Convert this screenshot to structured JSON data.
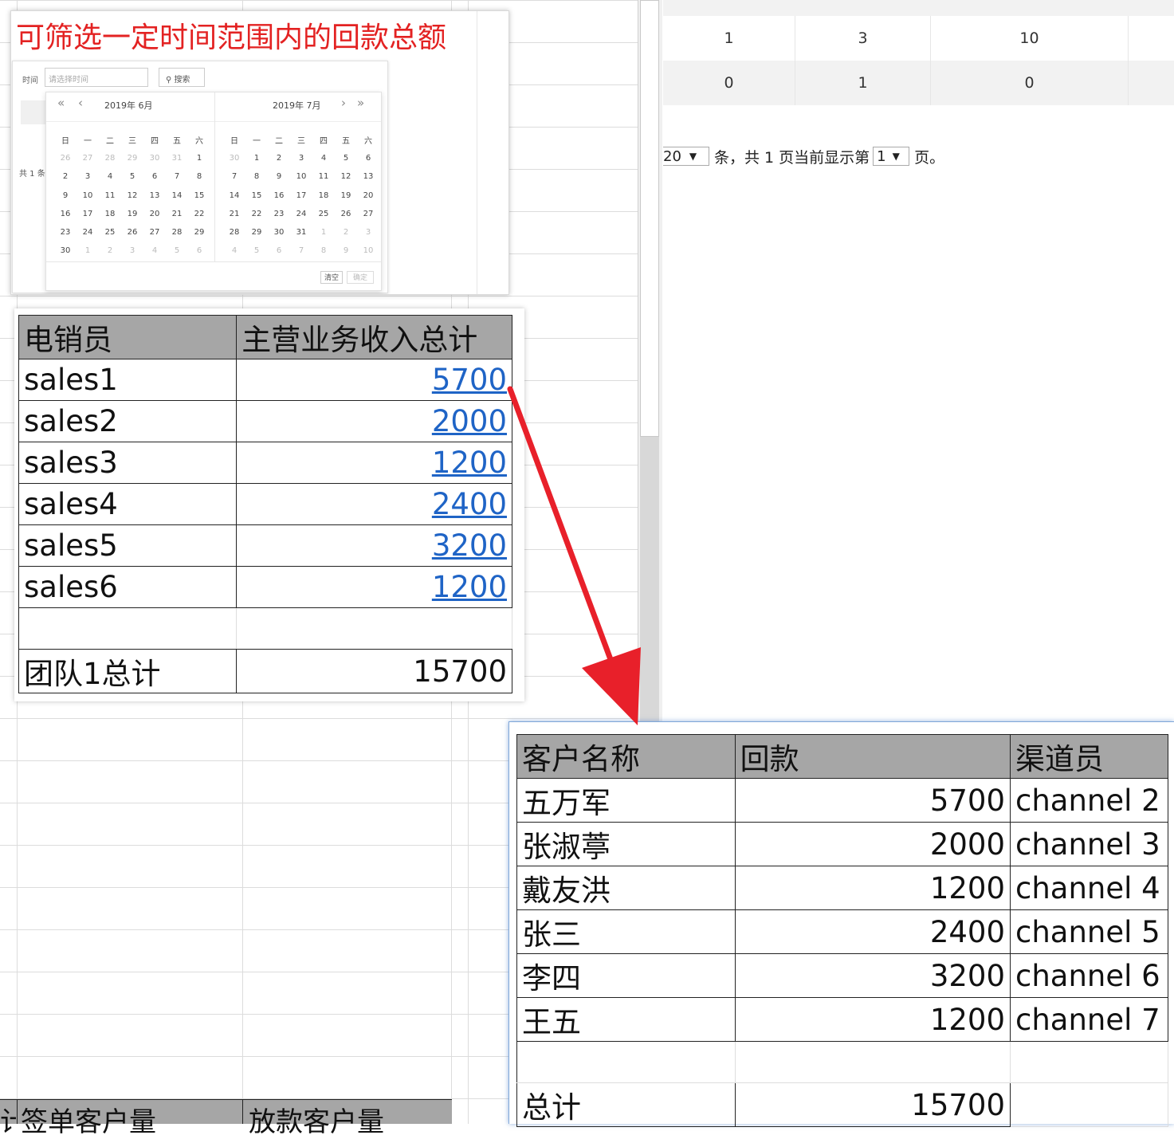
{
  "top_right_table": {
    "rows": [
      [
        "1",
        "3",
        "10"
      ],
      [
        "0",
        "1",
        "0"
      ]
    ]
  },
  "pager": {
    "page_size": "20",
    "text_1": "条，共 1 页当前显示第",
    "current_page": "1",
    "text_2": "页。"
  },
  "screenshot": {
    "title": "可筛选一定时间范围内的回款总额",
    "time_label": "时间",
    "time_placeholder": "请选择时间",
    "search_label": "搜索",
    "total_hint": "共 1 条",
    "left_month": "2019年  6月",
    "right_month": "2019年  7月",
    "weekdays": [
      "日",
      "一",
      "二",
      "三",
      "四",
      "五",
      "六"
    ],
    "clear_label": "清空",
    "ok_label": "确定",
    "june_weeks": [
      [
        "26",
        "27",
        "28",
        "29",
        "30",
        "31",
        "1"
      ],
      [
        "2",
        "3",
        "4",
        "5",
        "6",
        "7",
        "8"
      ],
      [
        "9",
        "10",
        "11",
        "12",
        "13",
        "14",
        "15"
      ],
      [
        "16",
        "17",
        "18",
        "19",
        "20",
        "21",
        "22"
      ],
      [
        "23",
        "24",
        "25",
        "26",
        "27",
        "28",
        "29"
      ],
      [
        "30",
        "1",
        "2",
        "3",
        "4",
        "5",
        "6"
      ]
    ],
    "july_weeks": [
      [
        "30",
        "1",
        "2",
        "3",
        "4",
        "5",
        "6"
      ],
      [
        "7",
        "8",
        "9",
        "10",
        "11",
        "12",
        "13"
      ],
      [
        "14",
        "15",
        "16",
        "17",
        "18",
        "19",
        "20"
      ],
      [
        "21",
        "22",
        "23",
        "24",
        "25",
        "26",
        "27"
      ],
      [
        "28",
        "29",
        "30",
        "31",
        "1",
        "2",
        "3"
      ],
      [
        "4",
        "5",
        "6",
        "7",
        "8",
        "9",
        "10"
      ]
    ]
  },
  "sales_table": {
    "headers": [
      "电销员",
      "主营业务收入总计"
    ],
    "rows": [
      [
        "sales1",
        "5700"
      ],
      [
        "sales2",
        "2000"
      ],
      [
        "sales3",
        "1200"
      ],
      [
        "sales4",
        "2400"
      ],
      [
        "sales5",
        "3200"
      ],
      [
        "sales6",
        "1200"
      ]
    ],
    "total_label": "团队1总计",
    "total_value": "15700"
  },
  "customer_table": {
    "headers": [
      "客户名称",
      "回款",
      "渠道员"
    ],
    "rows": [
      [
        "五万军",
        "5700",
        "channel 2"
      ],
      [
        "张淑葶",
        "2000",
        "channel 3"
      ],
      [
        "戴友洪",
        "1200",
        "channel 4"
      ],
      [
        "张三",
        "2400",
        "channel 5"
      ],
      [
        "李四",
        "3200",
        "channel 6"
      ],
      [
        "王五",
        "1200",
        "channel 7"
      ]
    ],
    "total_label": "总计",
    "total_value": "15700"
  },
  "bottom_fragment": {
    "cell0": "计",
    "cell1": "签单客户量",
    "cell2": "放款客户量"
  },
  "colors": {
    "arrow": "#e8202a",
    "header_gray": "#a6a6a6",
    "link_blue": "#1f64c6",
    "title_red": "#e32222"
  }
}
